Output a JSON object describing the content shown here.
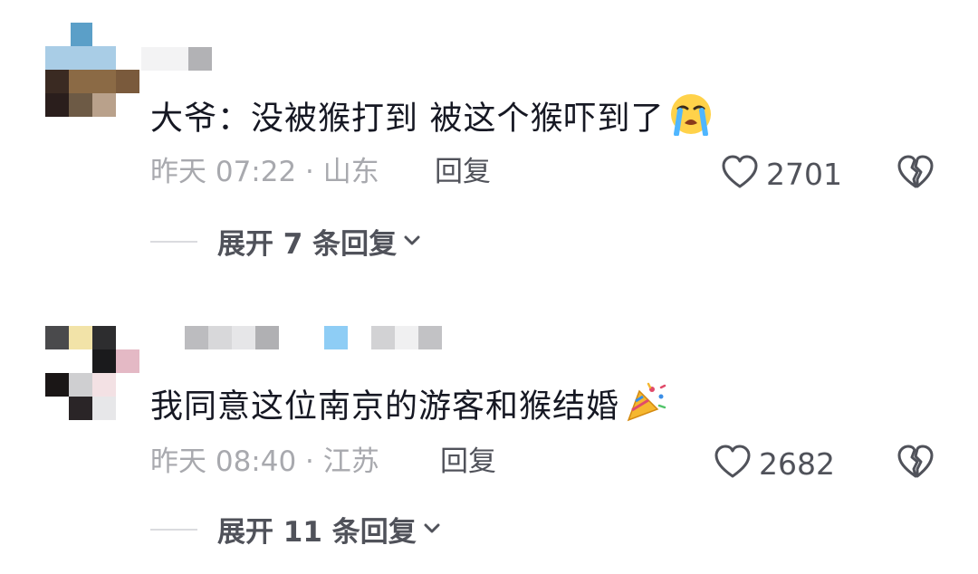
{
  "comments": [
    {
      "text": "大爷：没被猴打到 被这个猴吓到了",
      "emoji": "crying-face-icon",
      "time": "昨天 07:22",
      "location": "山东",
      "reply_label": "回复",
      "likes": "2701",
      "expand_label": "展开 7 条回复"
    },
    {
      "text": "我同意这位南京的游客和猴结婚",
      "emoji": "party-popper-icon",
      "time": "昨天 08:40",
      "location": "江苏",
      "reply_label": "回复",
      "likes": "2682",
      "expand_label": "展开 11 条回复"
    }
  ]
}
